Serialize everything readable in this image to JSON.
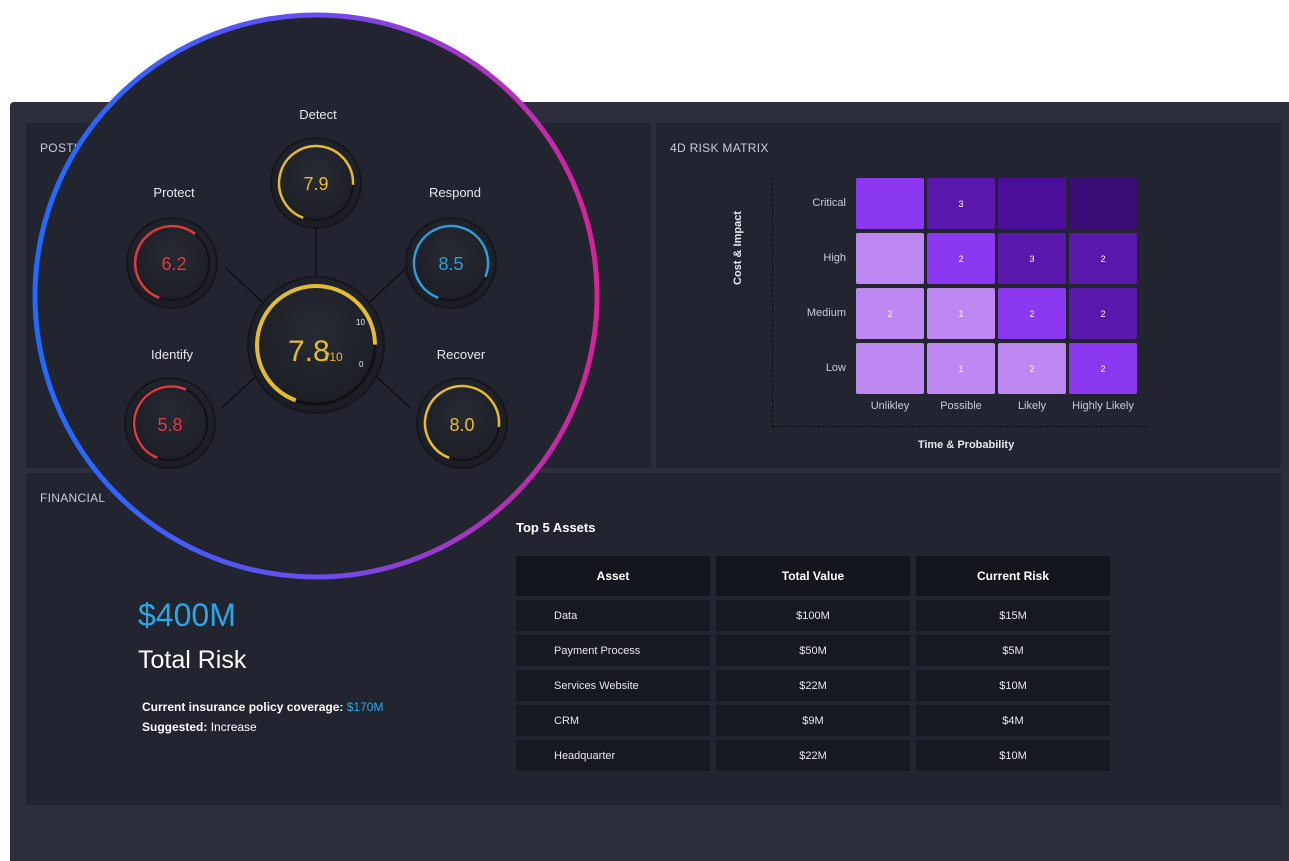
{
  "posture": {
    "title": "POSTURE",
    "overall": {
      "value": "7.8",
      "denominator": "/10",
      "max_label": "10",
      "min_label": "0",
      "fraction": 0.78,
      "color": "#e4bc32"
    },
    "functions": {
      "detect": {
        "label": "Detect",
        "value": "7.9",
        "fraction": 0.79,
        "color": "#e4bc32"
      },
      "protect": {
        "label": "Protect",
        "value": "6.2",
        "fraction": 0.62,
        "color": "#e0393e"
      },
      "respond": {
        "label": "Respond",
        "value": "8.5",
        "fraction": 0.85,
        "color": "#2b9fd8"
      },
      "identify": {
        "label": "Identify",
        "value": "5.8",
        "fraction": 0.58,
        "color": "#e0393e"
      },
      "recover": {
        "label": "Recover",
        "value": "8.0",
        "fraction": 0.8,
        "color": "#e4bc32"
      }
    }
  },
  "matrix": {
    "title": "4D RISK MATRIX",
    "y_axis_label": "Cost & Impact",
    "x_axis_label": "Time & Probability",
    "rows": [
      "Critical",
      "High",
      "Medium",
      "Low"
    ],
    "columns": [
      "Unlikley",
      "Possible",
      "Likely",
      "Highly Likely"
    ],
    "cells": [
      [
        {
          "value": "",
          "color": "#8c38f0"
        },
        {
          "value": "3",
          "color": "#5a18ad"
        },
        {
          "value": "",
          "color": "#4c0f9c"
        },
        {
          "value": "",
          "color": "#3a0c76"
        }
      ],
      [
        {
          "value": "",
          "color": "#be88f2"
        },
        {
          "value": "2",
          "color": "#8c38f0"
        },
        {
          "value": "3",
          "color": "#5a18ad"
        },
        {
          "value": "2",
          "color": "#5a18ad"
        }
      ],
      [
        {
          "value": "2",
          "color": "#be88f2"
        },
        {
          "value": "1",
          "color": "#be88f2"
        },
        {
          "value": "2",
          "color": "#8c38f0"
        },
        {
          "value": "2",
          "color": "#5a18ad"
        }
      ],
      [
        {
          "value": "",
          "color": "#be88f2"
        },
        {
          "value": "1",
          "color": "#be88f2"
        },
        {
          "value": "2",
          "color": "#be88f2"
        },
        {
          "value": "2",
          "color": "#8c38f0"
        }
      ]
    ]
  },
  "financial": {
    "title": "FINANCIAL",
    "total_amount": "$400M",
    "total_label": "Total Risk",
    "coverage_label": "Current insurance policy coverage:",
    "coverage_value": "$170M",
    "suggested_label": "Suggested:",
    "suggested_value": "Increase",
    "assets_title": "Top 5 Assets",
    "headers": [
      "Asset",
      "Total Value",
      "Current Risk"
    ],
    "rows": [
      [
        "Data",
        "$100M",
        "$15M"
      ],
      [
        "Payment Process",
        "$50M",
        "$5M"
      ],
      [
        "Services Website",
        "$22M",
        "$10M"
      ],
      [
        "CRM",
        "$9M",
        "$4M"
      ],
      [
        "Headquarter",
        "$22M",
        "$10M"
      ]
    ]
  }
}
